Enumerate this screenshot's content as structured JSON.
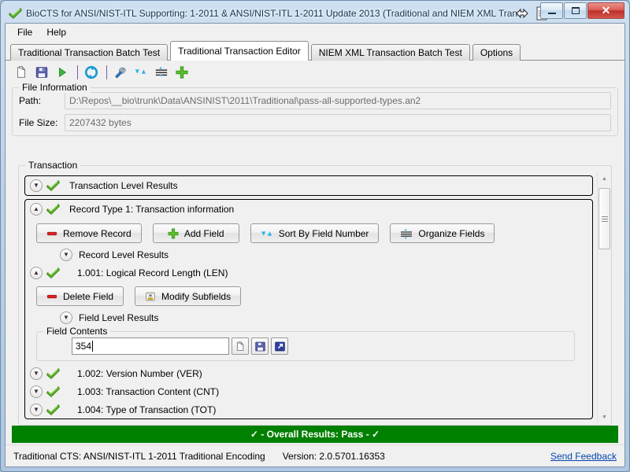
{
  "window": {
    "title": "BioCTS for ANSI/NIST-ITL Supporting: 1-2011 & ANSI/NIST-ITL 1-2011 Update 2013 (Traditional and NIEM XML Transacti...",
    "icon": "green-check-icon",
    "minimize_label": "Minimize",
    "maximize_label": "Maximize",
    "close_label": "Close"
  },
  "menu": {
    "items": [
      {
        "label": "File"
      },
      {
        "label": "Help"
      }
    ]
  },
  "tabs": [
    {
      "label": "Traditional Transaction Batch Test",
      "active": false
    },
    {
      "label": "Traditional Transaction Editor",
      "active": true
    },
    {
      "label": "NIEM XML Transaction Batch Test",
      "active": false
    },
    {
      "label": "Options",
      "active": false
    }
  ],
  "toolbar": {
    "buttons": [
      {
        "name": "new-icon",
        "title": "New"
      },
      {
        "name": "save-icon",
        "title": "Save"
      },
      {
        "name": "run-icon",
        "title": "Run"
      },
      {
        "name": "separator-1",
        "title": ""
      },
      {
        "name": "refresh-icon",
        "title": "Refresh"
      },
      {
        "name": "separator-2",
        "title": ""
      },
      {
        "name": "wrench-icon",
        "title": "Tools"
      },
      {
        "name": "sort-icon",
        "title": "Sort"
      },
      {
        "name": "organize-icon",
        "title": "Organize"
      },
      {
        "name": "add-icon",
        "title": "Add"
      }
    ]
  },
  "file_information": {
    "group_label": "File Information",
    "path_label": "Path:",
    "path_value": "D:\\Repos\\__bio\\trunk\\Data\\ANSINIST\\2011\\Traditional\\pass-all-supported-types.an2",
    "size_label": "File Size:",
    "size_value": "2207432 bytes"
  },
  "transaction": {
    "group_label": "Transaction",
    "transaction_level_results": "Transaction Level Results",
    "record": {
      "title": "Record Type 1: Transaction information",
      "buttons": [
        {
          "label": "Remove Record",
          "icon": "minus-red-icon"
        },
        {
          "label": "Add Field",
          "icon": "plus-green-icon"
        },
        {
          "label": "Sort By Field Number",
          "icon": "sort-blue-icon"
        },
        {
          "label": "Organize Fields",
          "icon": "organize-icon"
        }
      ],
      "record_level_results": "Record Level Results",
      "field": {
        "title": "1.001: Logical Record Length (LEN)",
        "buttons": [
          {
            "label": "Delete Field",
            "icon": "minus-red-icon"
          },
          {
            "label": "Modify Subfields",
            "icon": "subfields-icon"
          }
        ],
        "field_level_results": "Field Level Results",
        "field_contents_label": "Field Contents",
        "field_contents_value": "354",
        "field_contents_placeholder": "",
        "content_buttons": [
          {
            "name": "copy-icon",
            "title": "Copy"
          },
          {
            "name": "save-icon",
            "title": "Save"
          },
          {
            "name": "export-icon",
            "title": "Export"
          }
        ]
      }
    },
    "fields": [
      {
        "label": "1.002: Version Number (VER)",
        "status": "pass"
      },
      {
        "label": "1.003: Transaction Content (CNT)",
        "status": "pass"
      },
      {
        "label": "1.004: Type of Transaction (TOT)",
        "status": "pass"
      }
    ]
  },
  "result_bar": {
    "text": "✓ - Overall Results: Pass - ✓",
    "color": "#008000"
  },
  "status_bar": {
    "text": "Traditional CTS: ANSI/NIST-ITL 1-2011 Traditional Encoding",
    "version": "Version: 2.0.5701.16353",
    "feedback_link": "Send Feedback",
    "link_color": "#0645ad"
  }
}
